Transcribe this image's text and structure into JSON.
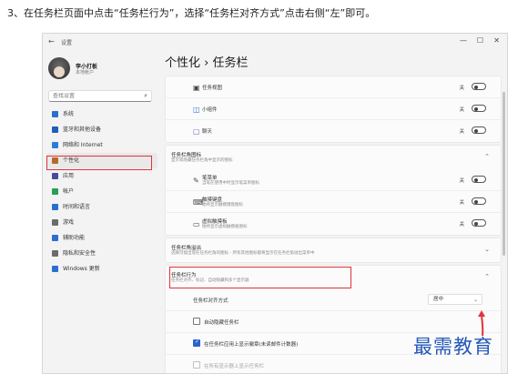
{
  "caption": "3、在任务栏页面中点击“任务栏行为”，选择“任务栏对齐方式”点击右侧“左”即可。",
  "window": {
    "title": "设置",
    "controls": [
      "—",
      "☐",
      "✕"
    ]
  },
  "profile": {
    "name": "李小打板",
    "sub": "本地帐户"
  },
  "search": {
    "placeholder": "查找设置"
  },
  "sidebar": {
    "items": [
      {
        "label": "系统",
        "color": "#2a6fd0"
      },
      {
        "label": "蓝牙和其他设备",
        "color": "#1f5fb8"
      },
      {
        "label": "网络和 Internet",
        "color": "#2a7ed8"
      },
      {
        "label": "个性化",
        "color": "#b56a2a"
      },
      {
        "label": "应用",
        "color": "#4b4b9a"
      },
      {
        "label": "帐户",
        "color": "#2a9d5a"
      },
      {
        "label": "时间和语言",
        "color": "#2a6fd0"
      },
      {
        "label": "游戏",
        "color": "#6b6b6b"
      },
      {
        "label": "辅助功能",
        "color": "#2a6fd0"
      },
      {
        "label": "隐私和安全性",
        "color": "#6b6b6b"
      },
      {
        "label": "Windows 更新",
        "color": "#2a6fd0"
      }
    ]
  },
  "heading": {
    "parent": "个性化",
    "sep": "›",
    "current": "任务栏"
  },
  "task_items": [
    {
      "icon": "▣",
      "label": "任务视图",
      "state": "关"
    },
    {
      "icon": "◫",
      "label": "小组件",
      "state": "关"
    },
    {
      "icon": "▢",
      "label": "聊天",
      "state": "关"
    }
  ],
  "corner": {
    "title": "任务栏角图标",
    "sub": "显示或隐藏任务栏角中显示的图标",
    "items": [
      {
        "icon": "✎",
        "label": "笔菜单",
        "sub": "当笔在使用中时显示笔菜单图标",
        "state": "关"
      },
      {
        "icon": "⌨",
        "label": "触摸键盘",
        "sub": "始终显示触摸键盘图标",
        "state": "关"
      },
      {
        "icon": "▭",
        "label": "虚拟触摸板",
        "sub": "始终显示虚拟触摸板图标",
        "state": "关"
      }
    ]
  },
  "overflow": {
    "title": "任务栏角溢出",
    "sub": "选择可能出现在任务栏角的图标 - 所有其他图标都将显示在任务栏角溢出菜单中"
  },
  "behavior": {
    "title": "任务栏行为",
    "sub": "任务栏对齐、标记、自动隐藏和多个显示器",
    "alignment_label": "任务栏对齐方式",
    "alignment_value": "居中",
    "checks": [
      {
        "label": "自动隐藏任务栏",
        "checked": false,
        "dim": false
      },
      {
        "label": "在任务栏应用上显示徽章(未读邮件计数器)",
        "checked": true,
        "dim": false
      },
      {
        "label": "在所有显示器上显示任务栏",
        "checked": false,
        "dim": true
      }
    ]
  },
  "watermark": "最需教育"
}
